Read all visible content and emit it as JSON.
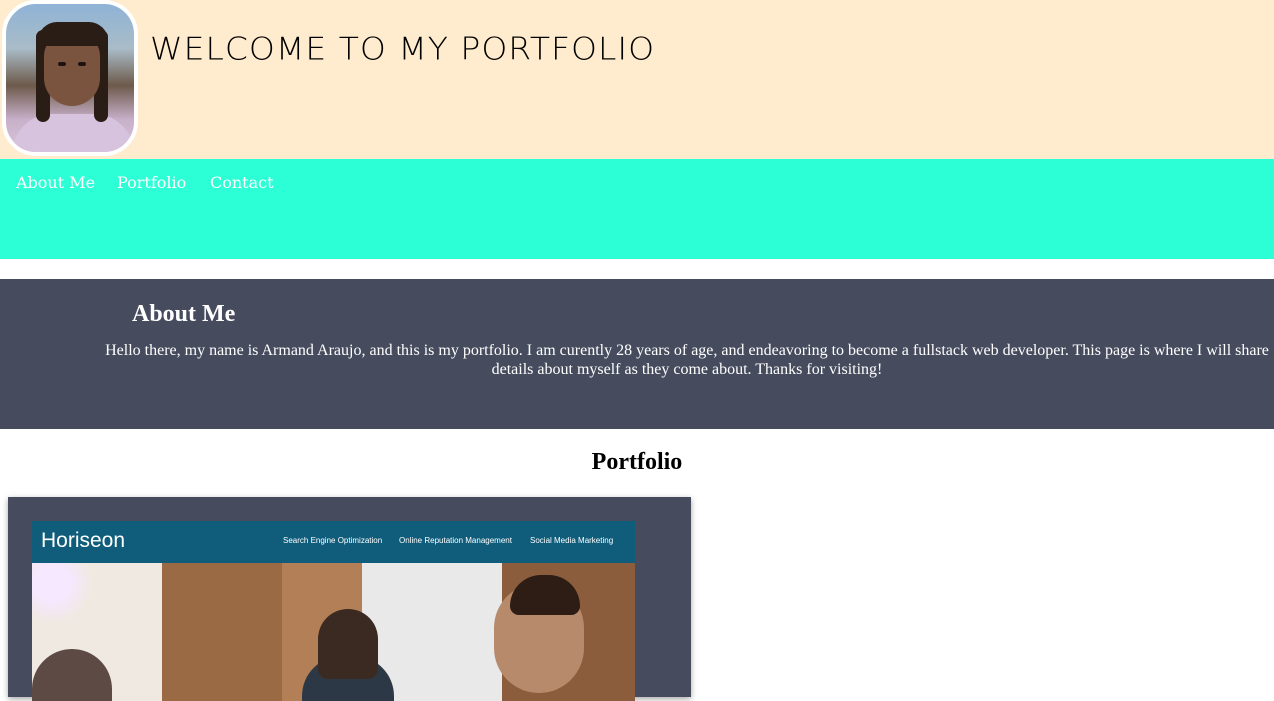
{
  "header": {
    "welcome_text": "WELCOME TO MY PORTFOLIO",
    "background_color": "#ffebcd"
  },
  "nav": {
    "background_color": "#2cffd5",
    "items": [
      {
        "label": "About Me"
      },
      {
        "label": "Portfolio"
      },
      {
        "label": "Contact"
      }
    ]
  },
  "about": {
    "heading": "About Me",
    "body": "Hello there, my name is Armand Araujo, and this is my portfolio. I am curently 28 years of age, and endeavoring to become a fullstack web developer. This page is where I will share details about myself as they come about. Thanks for visiting!",
    "background_color": "#464c5e"
  },
  "portfolio": {
    "heading": "Portfolio",
    "projects": [
      {
        "screenshot": {
          "brand": "Horiseon",
          "links": [
            "Search Engine Optimization",
            "Online Reputation Management",
            "Social Media Marketing"
          ]
        }
      }
    ]
  }
}
